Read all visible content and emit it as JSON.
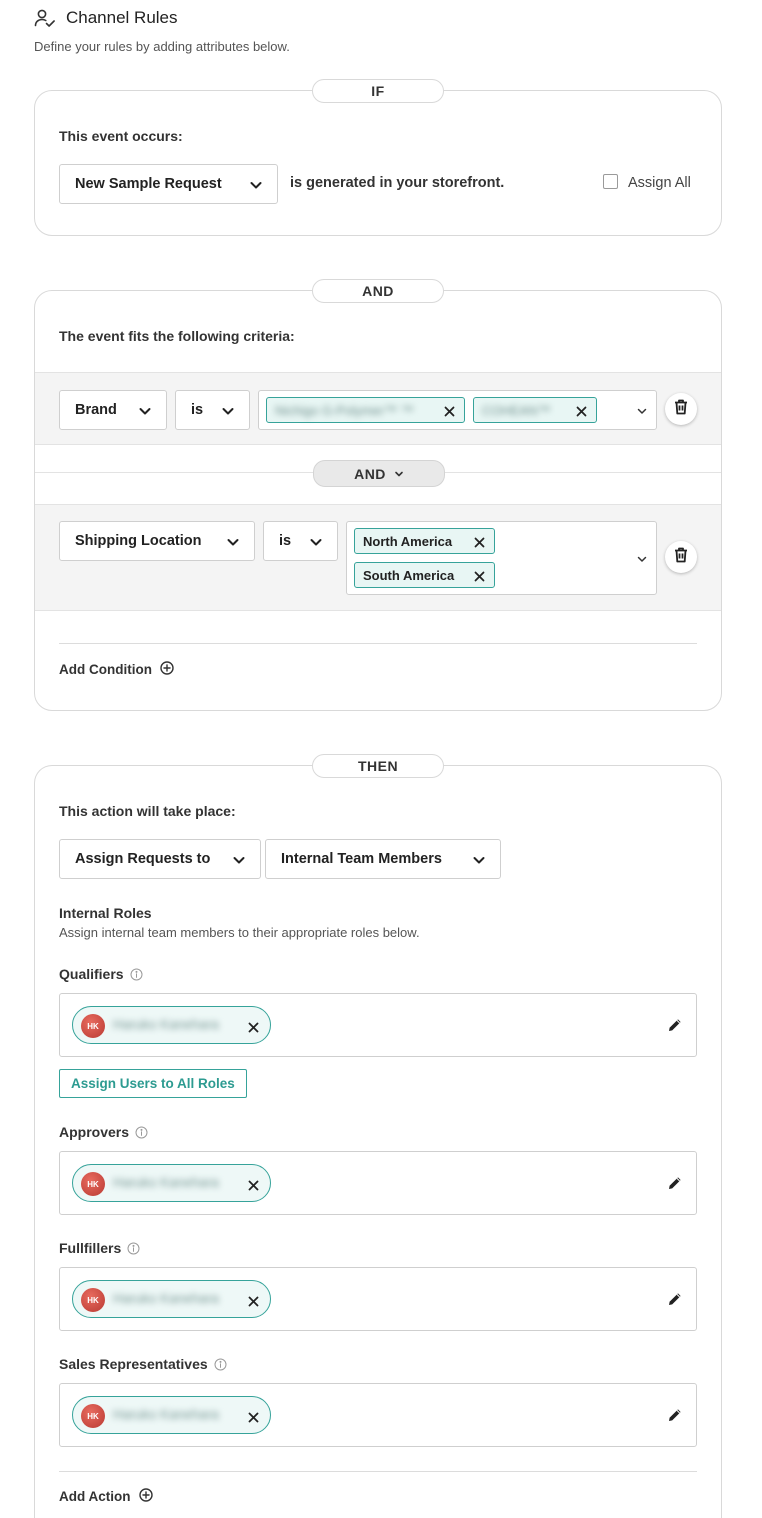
{
  "header": {
    "title": "Channel Rules",
    "subtitle": "Define your rules by adding attributes below.",
    "icon": "user-check-icon"
  },
  "if_section": {
    "pill": "IF",
    "label": "This event occurs:",
    "event_select": "New Sample Request",
    "suffix": "is generated in your storefront.",
    "assign_all": {
      "label": "Assign All",
      "checked": false
    }
  },
  "and_section": {
    "pill": "AND",
    "label": "The event fits the following criteria:",
    "conditions": [
      {
        "attribute": "Brand",
        "operator": "is",
        "values": [
          "Nichigo G-Polymer™ ™",
          "COHEAN™"
        ]
      },
      {
        "attribute": "Shipping Location",
        "operator": "is",
        "values": [
          "North America",
          "South America"
        ]
      }
    ],
    "joiner": "AND",
    "add_condition": "Add Condition"
  },
  "then_section": {
    "pill": "THEN",
    "label": "This action will take place:",
    "action_select": "Assign Requests to",
    "target_select": "Internal Team Members",
    "roles_heading": "Internal Roles",
    "roles_subheading": "Assign internal team members to their appropriate roles below.",
    "assign_all_roles": "Assign Users to All Roles",
    "roles": [
      {
        "label": "Qualifiers",
        "user_initials": "HK",
        "user_name": "Haruko Kanehara"
      },
      {
        "label": "Approvers",
        "user_initials": "HK",
        "user_name": "Haruko Kanehara"
      },
      {
        "label": "Fullfillers",
        "user_initials": "HK",
        "user_name": "Haruko Kanehara"
      },
      {
        "label": "Sales Representatives",
        "user_initials": "HK",
        "user_name": "Haruko Kanehara"
      }
    ],
    "add_action": "Add Action"
  },
  "colors": {
    "accent": "#36a39a",
    "tag_bg": "#e8f6f4",
    "band_bg": "#f4f4f4",
    "avatar": "#c9463d"
  }
}
